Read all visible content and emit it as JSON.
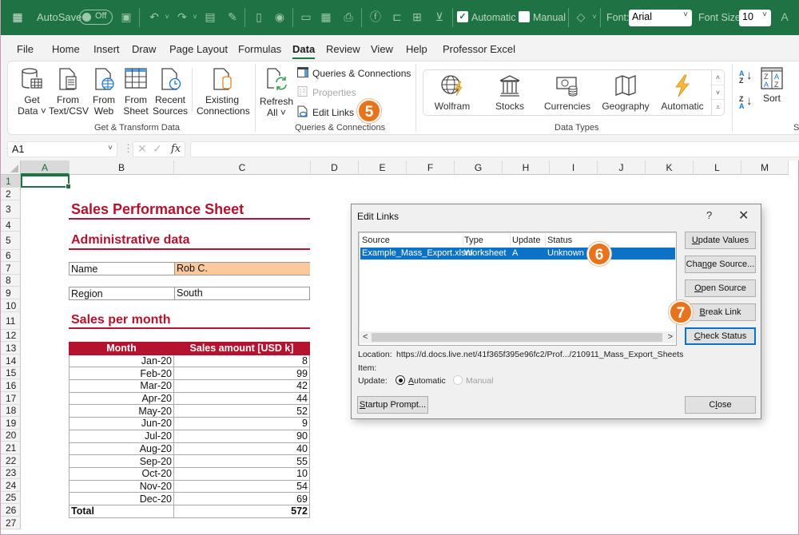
{
  "titlebar": {
    "autosave_label": "AutoSave",
    "autosave_state": "Off",
    "calc_automatic_label": "Automatic",
    "calc_automatic_checked": true,
    "calc_manual_label": "Manual",
    "calc_manual_checked": false,
    "font_label": "Font:",
    "font_value": "Arial",
    "font_size_label": "Font Size:",
    "font_size_value": "10",
    "icons": [
      "excel-logo-icon",
      "save-icon",
      "undo-icon",
      "redo-icon",
      "form-icon",
      "format-painter-icon",
      "file-icon",
      "record-icon",
      "image-icon",
      "save-as-icon",
      "print-icon",
      "function-icon",
      "shapes-icon",
      "arrange-icon",
      "clear-filter-icon",
      "eraser-icon",
      "grow-font-icon"
    ]
  },
  "tabs": [
    "File",
    "Home",
    "Insert",
    "Draw",
    "Page Layout",
    "Formulas",
    "Data",
    "Review",
    "View",
    "Help",
    "Professor Excel"
  ],
  "active_tab": "Data",
  "ribbon": {
    "get_transform": {
      "label": "Get & Transform Data",
      "buttons": [
        {
          "line1": "Get",
          "line2": "Data ˅"
        },
        {
          "line1": "From",
          "line2": "Text/CSV"
        },
        {
          "line1": "From",
          "line2": "Web"
        },
        {
          "line1": "From",
          "line2": "Sheet"
        },
        {
          "line1": "Recent",
          "line2": "Sources"
        },
        {
          "line1": "Existing",
          "line2": "Connections"
        }
      ]
    },
    "queries": {
      "label": "Queries & Connections",
      "refresh_line1": "Refresh",
      "refresh_line2": "All ˅",
      "queries_connections": "Queries & Connections",
      "properties": "Properties",
      "edit_links": "Edit Links"
    },
    "data_types": {
      "label": "Data Types",
      "items": [
        "Wolfram",
        "Stocks",
        "Currencies",
        "Geography",
        "Automatic"
      ]
    },
    "sort": {
      "label": "Sort",
      "group_label_partial": "S"
    }
  },
  "callouts": {
    "step5": "5",
    "step6": "6",
    "step7": "7"
  },
  "formula_bar": {
    "name_box": "A1",
    "fx": "fx",
    "formula": ""
  },
  "grid": {
    "columns": [
      "A",
      "B",
      "C",
      "D",
      "E",
      "F",
      "G",
      "H",
      "I",
      "J",
      "K",
      "L",
      "M"
    ],
    "rows": [
      "1",
      "2",
      "3",
      "4",
      "5",
      "6",
      "7",
      "8",
      "9",
      "10",
      "11",
      "12",
      "13",
      "14",
      "15",
      "16",
      "17",
      "18",
      "19",
      "20",
      "21",
      "22",
      "23",
      "24",
      "25",
      "26",
      "27"
    ],
    "selected_cell": "A1"
  },
  "sheet": {
    "title": "Sales Performance Sheet",
    "admin_heading": "Administrative data",
    "name_label": "Name",
    "name_value": "Rob C.",
    "region_label": "Region",
    "region_value": "South",
    "sales_heading": "Sales per month",
    "table_headers": [
      "Month",
      "Sales amount [USD k]"
    ],
    "sales": [
      {
        "month": "Jan-20",
        "amount": "8"
      },
      {
        "month": "Feb-20",
        "amount": "99"
      },
      {
        "month": "Mar-20",
        "amount": "42"
      },
      {
        "month": "Apr-20",
        "amount": "44"
      },
      {
        "month": "May-20",
        "amount": "52"
      },
      {
        "month": "Jun-20",
        "amount": "9"
      },
      {
        "month": "Jul-20",
        "amount": "90"
      },
      {
        "month": "Aug-20",
        "amount": "40"
      },
      {
        "month": "Sep-20",
        "amount": "55"
      },
      {
        "month": "Oct-20",
        "amount": "10"
      },
      {
        "month": "Nov-20",
        "amount": "54"
      },
      {
        "month": "Dec-20",
        "amount": "69"
      }
    ],
    "total_label": "Total",
    "total_value": "572"
  },
  "dialog": {
    "title": "Edit Links",
    "help": "?",
    "close_glyph": "✕",
    "list_headers": [
      "Source",
      "Type",
      "Update",
      "Status"
    ],
    "links": [
      {
        "source": "Example_Mass_Export.xlsm",
        "type": "Worksheet",
        "update": "A",
        "status": "Unknown"
      }
    ],
    "buttons": {
      "update_values": {
        "pre": "",
        "ul": "U",
        "post": "pdate Values"
      },
      "change_source": {
        "pre": "Cha",
        "ul": "n",
        "post": "ge Source..."
      },
      "open_source": {
        "pre": "",
        "ul": "O",
        "post": "pen Source"
      },
      "break_link": {
        "pre": "",
        "ul": "B",
        "post": "reak Link"
      },
      "check_status": {
        "pre": "",
        "ul": "C",
        "post": "heck Status"
      },
      "startup_prompt": {
        "pre": "",
        "ul": "S",
        "post": "tartup Prompt..."
      },
      "close": {
        "pre": "C",
        "ul": "l",
        "post": "ose"
      }
    },
    "location_label": "Location:",
    "location_value": "https://d.docs.live.net/41f365f395e96fc2/Prof.../210911_Mass_Export_Sheets",
    "item_label": "Item:",
    "update_label": "Update:",
    "update_automatic": {
      "ul": "A",
      "post": "utomatic"
    },
    "update_manual": "Manual",
    "update_selected": "Automatic"
  },
  "colors": {
    "excel_green": "#1f7244",
    "heading_red": "#b4122e",
    "highlight_orange": "#fcc99c",
    "callout_orange": "#e8731d",
    "selection_blue": "#0c72c6"
  }
}
